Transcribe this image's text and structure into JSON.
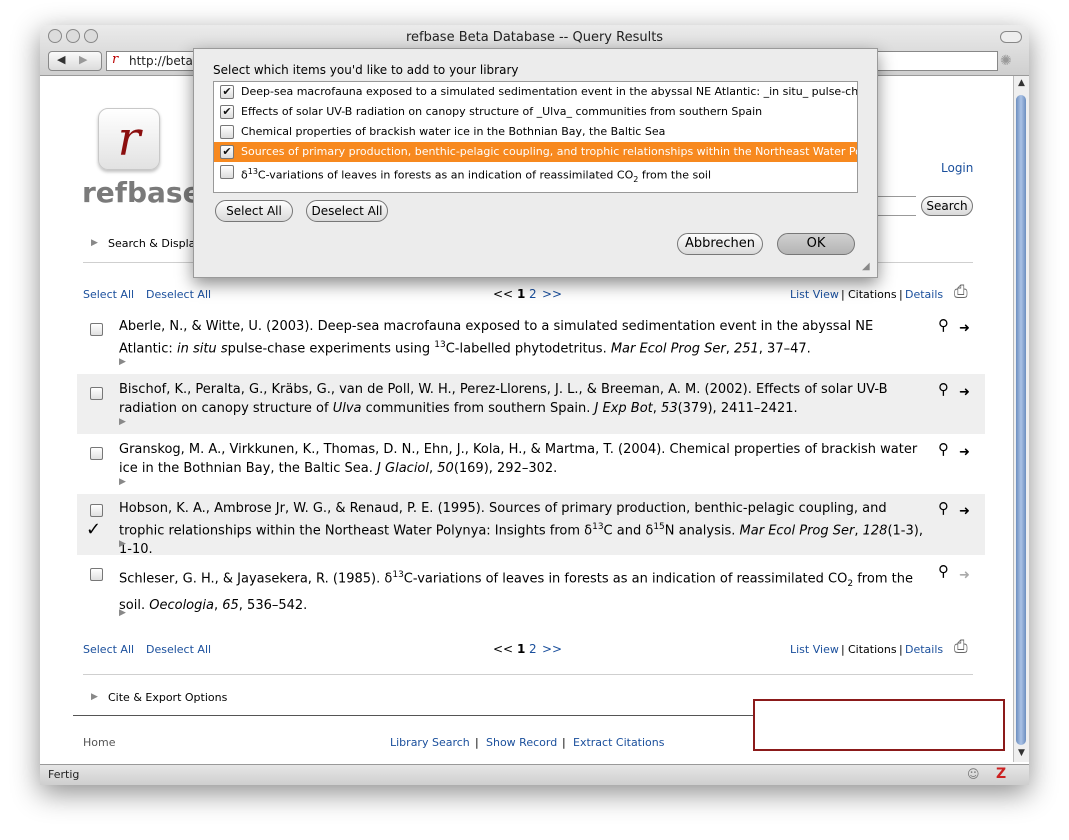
{
  "window": {
    "title": "refbase Beta Database -- Query Results",
    "url": "http://beta",
    "status": "Fertig"
  },
  "logo": {
    "letter": "r",
    "word": "refbase"
  },
  "header": {
    "login": "Login",
    "search_button": "Search",
    "search_display": "Search & Display"
  },
  "toolbar": {
    "select_all": "Select All",
    "deselect_all": "Deselect All",
    "pager_prev": "<<",
    "page_current": "1",
    "page_next_num": "2",
    "pager_next": ">>",
    "list_view": "List View",
    "sep1": "|",
    "citations": "Citations",
    "sep2": "|",
    "details": "Details"
  },
  "records": [
    {
      "authors": "Aberle, N., & Witte, U. (2003). Deep-sea macrofauna exposed to a simulated sedimentation event in the abyssal NE Atlantic:",
      "italic1": "in situ",
      "rest1": "pulse-chase experiments using",
      "sup": "13",
      "rest2": "C-labelled phytodetritus.",
      "journal": "Mar Ecol Prog Ser",
      "vol": "251",
      "pages": ", 37–47."
    },
    {
      "line1": "Bischof, K., Peralta, G., Kräbs, G., van de Poll, W. H., Perez-Llorens, J. L., & Breeman, A. M. (2002). Effects of solar UV-B radiation",
      "pre": "on canopy structure of",
      "italic1": "Ulva",
      "rest1": "communities from southern Spain.",
      "journal": "J Exp Bot",
      "vol": "53",
      "pages": "(379), 2411–2421."
    },
    {
      "line1": "Granskog, M. A., Virkkunen, K., Thomas, D. N., Ehn, J., Kola, H., & Martma, T. (2004). Chemical properties of brackish water ice in",
      "rest1": "the Bothnian Bay, the Baltic Sea.",
      "journal": "J Glaciol",
      "vol": "50",
      "pages": "(169), 292–302."
    },
    {
      "line1": "Hobson, K. A., Ambrose Jr, W. G., & Renaud, P. E. (1995). Sources of primary production, benthic-pelagic coupling, and trophic",
      "pre": "relationships within the Northeast Water Polynya: Insights from δ",
      "sup1": "13",
      "mid": "C and δ",
      "sup2": "15",
      "rest1": "N analysis.",
      "journal": "Mar Ecol Prog Ser",
      "vol": "128",
      "pages": "(1-3), 1-10."
    },
    {
      "pre": "Schleser, G. H., & Jayasekera, R. (1985). δ",
      "sup": "13",
      "rest1": "C-variations of leaves in forests as an indication of reassimilated CO",
      "sub": "2",
      "rest2": "from the soil.",
      "journal": "Oecologia",
      "vol": "65",
      "pages": ", 536–542."
    }
  ],
  "cite_export": "Cite & Export Options",
  "footer": {
    "home": "Home",
    "library_search": "Library Search",
    "sep1": "|",
    "show_record": "Show Record",
    "sep2": "|",
    "extract_citations": "Extract Citations"
  },
  "dialog": {
    "prompt": "Select which items you'd like to add to your library",
    "items": [
      {
        "label": "Deep-sea macrofauna exposed to a simulated sedimentation event in the abyssal NE Atlantic: _in situ_ pulse-chase",
        "checked": "✔"
      },
      {
        "label": "Effects of solar UV-B radiation on canopy structure of _Ulva_ communities from southern Spain",
        "checked": "✔"
      },
      {
        "label": "Chemical properties of brackish water ice in the Bothnian Bay, the Baltic Sea",
        "checked": ""
      },
      {
        "label": "Sources of primary production, benthic-pelagic coupling, and trophic relationships within the Northeast Water Polynya",
        "checked": "✔"
      },
      {
        "pre": "δ",
        "sup": "13",
        "mid": "C-variations of leaves in forests as an indication of reassimilated CO",
        "sub": "2",
        "post": " from the soil",
        "checked": ""
      }
    ],
    "select_all": "Select All",
    "deselect_all": "Deselect All",
    "cancel": "Abbrechen",
    "ok": "OK"
  },
  "colors": {
    "link": "#1a4f9c",
    "highlight": "#f7891f",
    "logo_red": "#8b0e0e",
    "row_alt": "#efefef"
  },
  "icons": [
    "key-icon",
    "arrow-right-icon",
    "print-icon",
    "disclosure-triangle-icon",
    "checkmark-icon"
  ]
}
